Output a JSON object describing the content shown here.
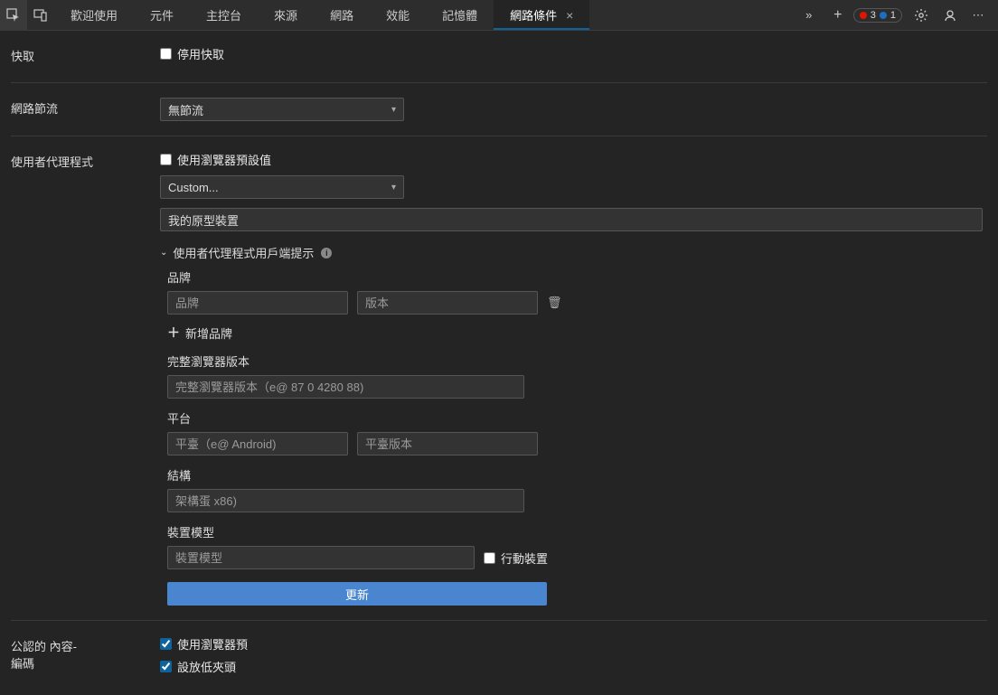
{
  "tabs": {
    "welcome": "歡迎使用",
    "elements": "元件",
    "console": "主控台",
    "sources": "來源",
    "network": "網路",
    "performance": "效能",
    "memory": "記憶體",
    "network_conditions": "網路條件"
  },
  "badges": {
    "errors": "3",
    "info": "1"
  },
  "cache": {
    "title": "快取",
    "disable_label": "停用快取"
  },
  "throttle": {
    "title": "網路節流",
    "value": "無節流"
  },
  "ua": {
    "title": "使用者代理程式",
    "use_default_label": "使用瀏覽器預設值",
    "preset_value": "Custom...",
    "ua_string_value": "我的原型裝置",
    "hints_title": "使用者代理程式用戶端提示",
    "brand_label": "品牌",
    "brand_placeholder": "品牌",
    "version_placeholder": "版本",
    "add_brand": "新增品牌",
    "full_version_label": "完整瀏覽器版本",
    "full_version_placeholder": "完整瀏覽器版本（e@ 87 0 4280 88)",
    "platform_label": "平台",
    "platform_placeholder": "平臺（e@ Android)",
    "platform_version_placeholder": "平臺版本",
    "arch_label": "結構",
    "arch_placeholder": "架構蛋 x86)",
    "model_label": "裝置模型",
    "model_placeholder": "裝置模型",
    "mobile_label": "行動裝置",
    "update_btn": "更新"
  },
  "encoding": {
    "title1": "公認的 內容-",
    "title2": "編碼",
    "use_browser_default": "使用瀏覽器預",
    "deflate": "設放低夾頭"
  }
}
